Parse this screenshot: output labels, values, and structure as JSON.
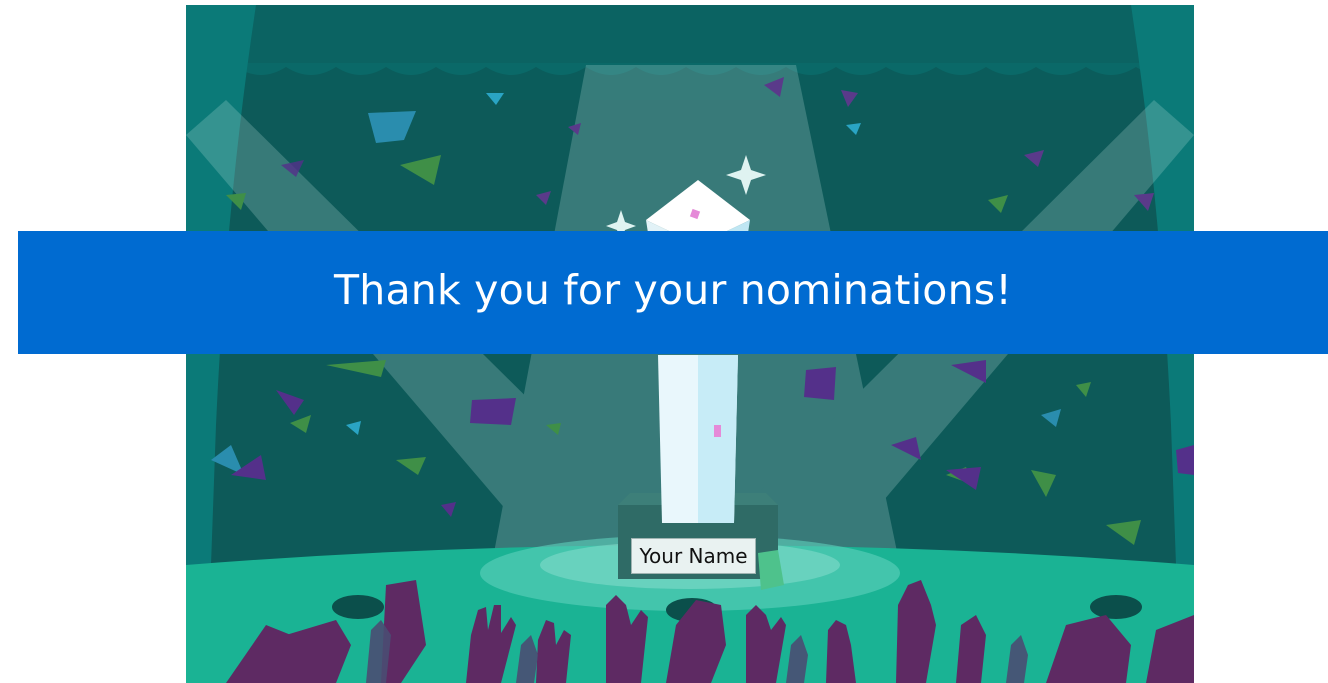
{
  "banner": {
    "message": "Thank you for your nominations!"
  },
  "trophy": {
    "name_plate": "Your Name"
  },
  "colors": {
    "banner_bg": "#006bd1",
    "stage_back": "#0c5f5e",
    "stage_floor": "#19b08f",
    "crowd": "#5e2a63"
  },
  "icons": [
    "sparkle-icon",
    "trophy-icon",
    "confetti",
    "raised-hands"
  ]
}
